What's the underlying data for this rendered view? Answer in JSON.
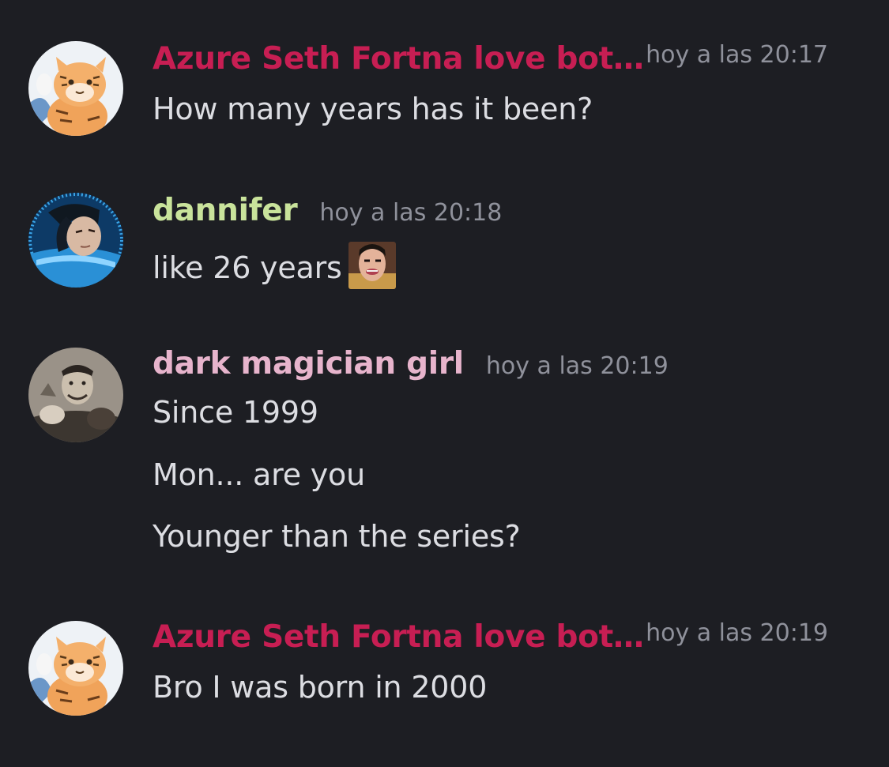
{
  "messages": [
    {
      "author": "Azure Seth Fortna love bot…",
      "author_color": "#c71e53",
      "time": "hoy a las 20:17",
      "lines": [
        "How many years has it been?"
      ]
    },
    {
      "author": "dannifer",
      "author_color": "#c9e39b",
      "time": "hoy a las 20:18",
      "lines": [
        "like 26 years"
      ],
      "emoji": "custom-face-emoji"
    },
    {
      "author": "dark magician girl",
      "author_color": "#e7b4cc",
      "time": "hoy a las 20:19",
      "lines": [
        "Since 1999",
        "Mon... are you",
        "Younger than the series?"
      ]
    },
    {
      "author": "Azure Seth Fortna love bot…",
      "author_color": "#c71e53",
      "time": "hoy a las 20:19",
      "lines": [
        "Bro I was born in 2000"
      ]
    }
  ],
  "colors": {
    "background": "#1d1e23",
    "message_text": "#dcdde2",
    "timestamp": "#8f919b"
  }
}
